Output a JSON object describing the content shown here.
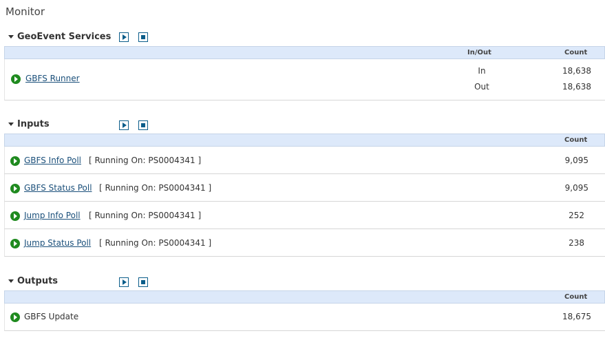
{
  "page": {
    "title": "Monitor"
  },
  "services": {
    "title": "GeoEvent Services",
    "columns": {
      "in_out": "In/Out",
      "count": "Count"
    },
    "rows": [
      {
        "name": "GBFS Runner",
        "in_label": "In",
        "in_count": "18,638",
        "out_label": "Out",
        "out_count": "18,638"
      }
    ]
  },
  "inputs": {
    "title": "Inputs",
    "columns": {
      "count": "Count"
    },
    "rows": [
      {
        "name": "GBFS Info Poll",
        "running": "[ Running On: PS0004341 ]",
        "count": "9,095"
      },
      {
        "name": "GBFS Status Poll",
        "running": "[ Running On: PS0004341 ]",
        "count": "9,095"
      },
      {
        "name": "Jump Info Poll",
        "running": "[ Running On: PS0004341 ]",
        "count": "252"
      },
      {
        "name": "Jump Status Poll",
        "running": "[ Running On: PS0004341 ]",
        "count": "238"
      }
    ]
  },
  "outputs": {
    "title": "Outputs",
    "columns": {
      "count": "Count"
    },
    "rows": [
      {
        "name": "GBFS Update",
        "count": "18,675"
      }
    ]
  },
  "colors": {
    "accent": "#0b5d8a",
    "status_running": "#1f8a1f",
    "header_bg": "#dde9fa"
  },
  "icons": {
    "play": "play-icon",
    "stop": "stop-icon",
    "status": "running-status-icon",
    "collapse": "caret-down-icon"
  }
}
